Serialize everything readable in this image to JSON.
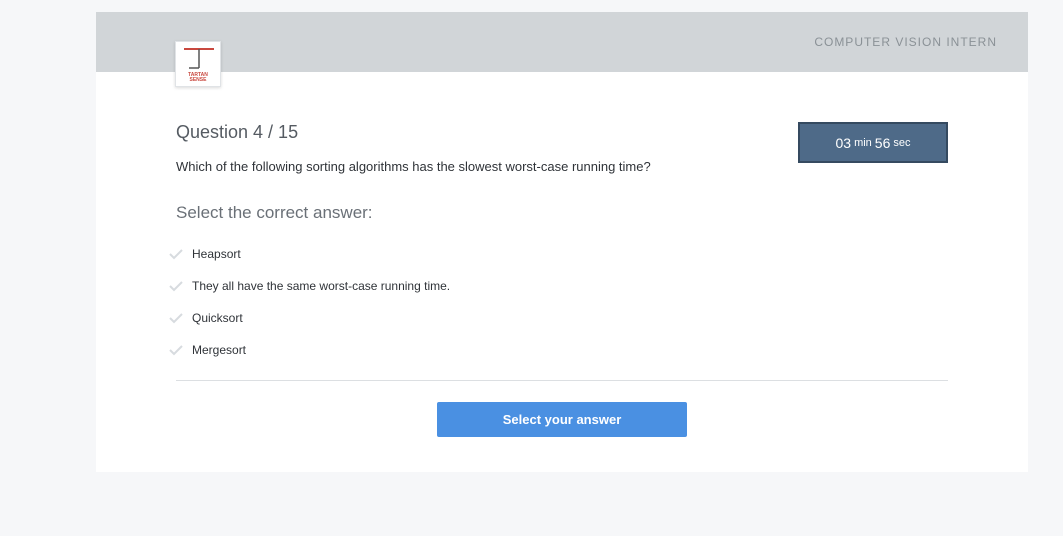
{
  "header": {
    "job_title": "COMPUTER VISION INTERN",
    "logo": {
      "line1": "TARTAN",
      "line2": "SENSE",
      "icon": "tartan-sense-logo"
    }
  },
  "question": {
    "number_label": "Question 4 / 15",
    "text": "Which of the following sorting algorithms has the slowest worst-case running time?",
    "prompt": "Select the correct answer:",
    "options": [
      {
        "label": "Heapsort",
        "icon": "checkmark-icon"
      },
      {
        "label": "They all have the same worst-case running time.",
        "icon": "checkmark-icon"
      },
      {
        "label": "Quicksort",
        "icon": "checkmark-icon"
      },
      {
        "label": "Mergesort",
        "icon": "checkmark-icon"
      }
    ]
  },
  "timer": {
    "minutes": "03",
    "min_unit": "min",
    "seconds": "56",
    "sec_unit": "sec"
  },
  "actions": {
    "submit_label": "Select your answer"
  },
  "colors": {
    "header_bg": "#d1d5d8",
    "timer_bg": "#4e6a88",
    "button_bg": "#4a90e2",
    "logo_accent": "#c9483f"
  }
}
